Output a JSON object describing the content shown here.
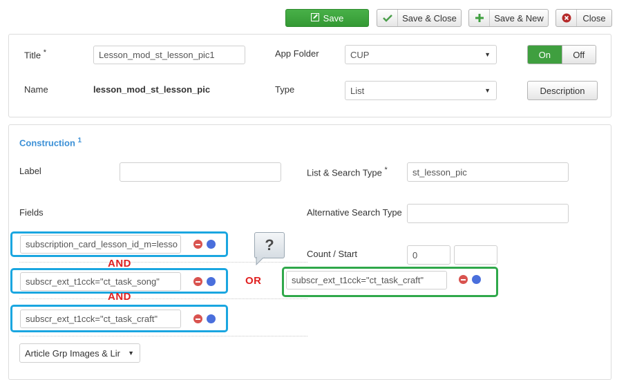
{
  "toolbar": {
    "save_label": "Save",
    "save_close_label": "Save & Close",
    "save_new_label": "Save & New",
    "close_label": "Close"
  },
  "form": {
    "title_label": "Title",
    "required_mark": "*",
    "title_value": "Lesson_mod_st_lesson_pic1",
    "app_folder_label": "App Folder",
    "app_folder_value": "CUP",
    "state_on": "On",
    "state_off": "Off",
    "name_label": "Name",
    "name_value": "lesson_mod_st_lesson_pic",
    "type_label": "Type",
    "type_value": "List",
    "description_label": "Description"
  },
  "construction": {
    "heading": "Construction",
    "heading_sup": "1",
    "label_label": "Label",
    "label_value": "",
    "list_search_type_label": "List & Search Type",
    "list_search_type_value": "st_lesson_pic",
    "fields_label": "Fields",
    "alt_search_type_label": "Alternative Search Type",
    "alt_search_type_value": "",
    "count_start_label": "Count / Start",
    "count_value": "0",
    "start_value": "",
    "fields": [
      "subscription_card_lesson_id_m=lesso",
      "subscr_ext_t1cck=\"ct_task_song\"",
      "subscr_ext_t1cck=\"ct_task_craft\""
    ],
    "or_field": "subscr_ext_t1cck=\"ct_task_craft\"",
    "bottom_select": "Article Grp Images & Lir"
  },
  "annotations": {
    "and1": "AND",
    "and2": "AND",
    "or": "OR",
    "question": "?"
  },
  "colors": {
    "highlight_blue": "#1aa6e0",
    "highlight_green": "#2fa84a",
    "annotation_red": "#e02020",
    "save_green": "#3f9f3f",
    "link_blue": "#3a8fd6"
  }
}
